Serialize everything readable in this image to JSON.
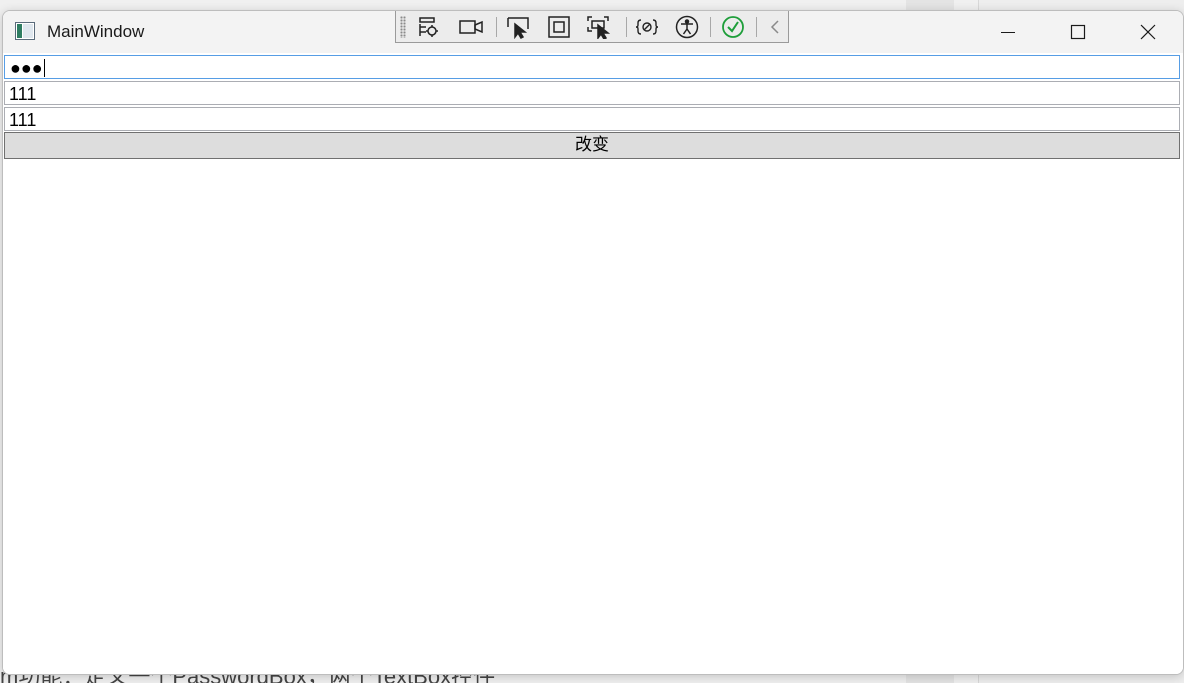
{
  "window": {
    "title": "MainWindow"
  },
  "debug_toolbar": {
    "icons": [
      "live-visual-tree-icon",
      "camera-icon",
      "select-element-icon",
      "display-layout-adorners-icon",
      "track-focused-element-icon",
      "binding-failures-icon",
      "accessibility-icon",
      "hot-reload-ok-icon",
      "collapse-toolbar-icon"
    ],
    "hot_reload_color": "#1e9e3a"
  },
  "form": {
    "password_mask": "●●●",
    "textbox1_value": "111",
    "textbox2_value": "111",
    "change_button_label": "改变"
  },
  "background": {
    "partial_text": "m功能：定义一个PasswordBox，两个TextBox控件"
  },
  "colors": {
    "focus_border": "#569de5",
    "button_bg": "#dddddd"
  }
}
